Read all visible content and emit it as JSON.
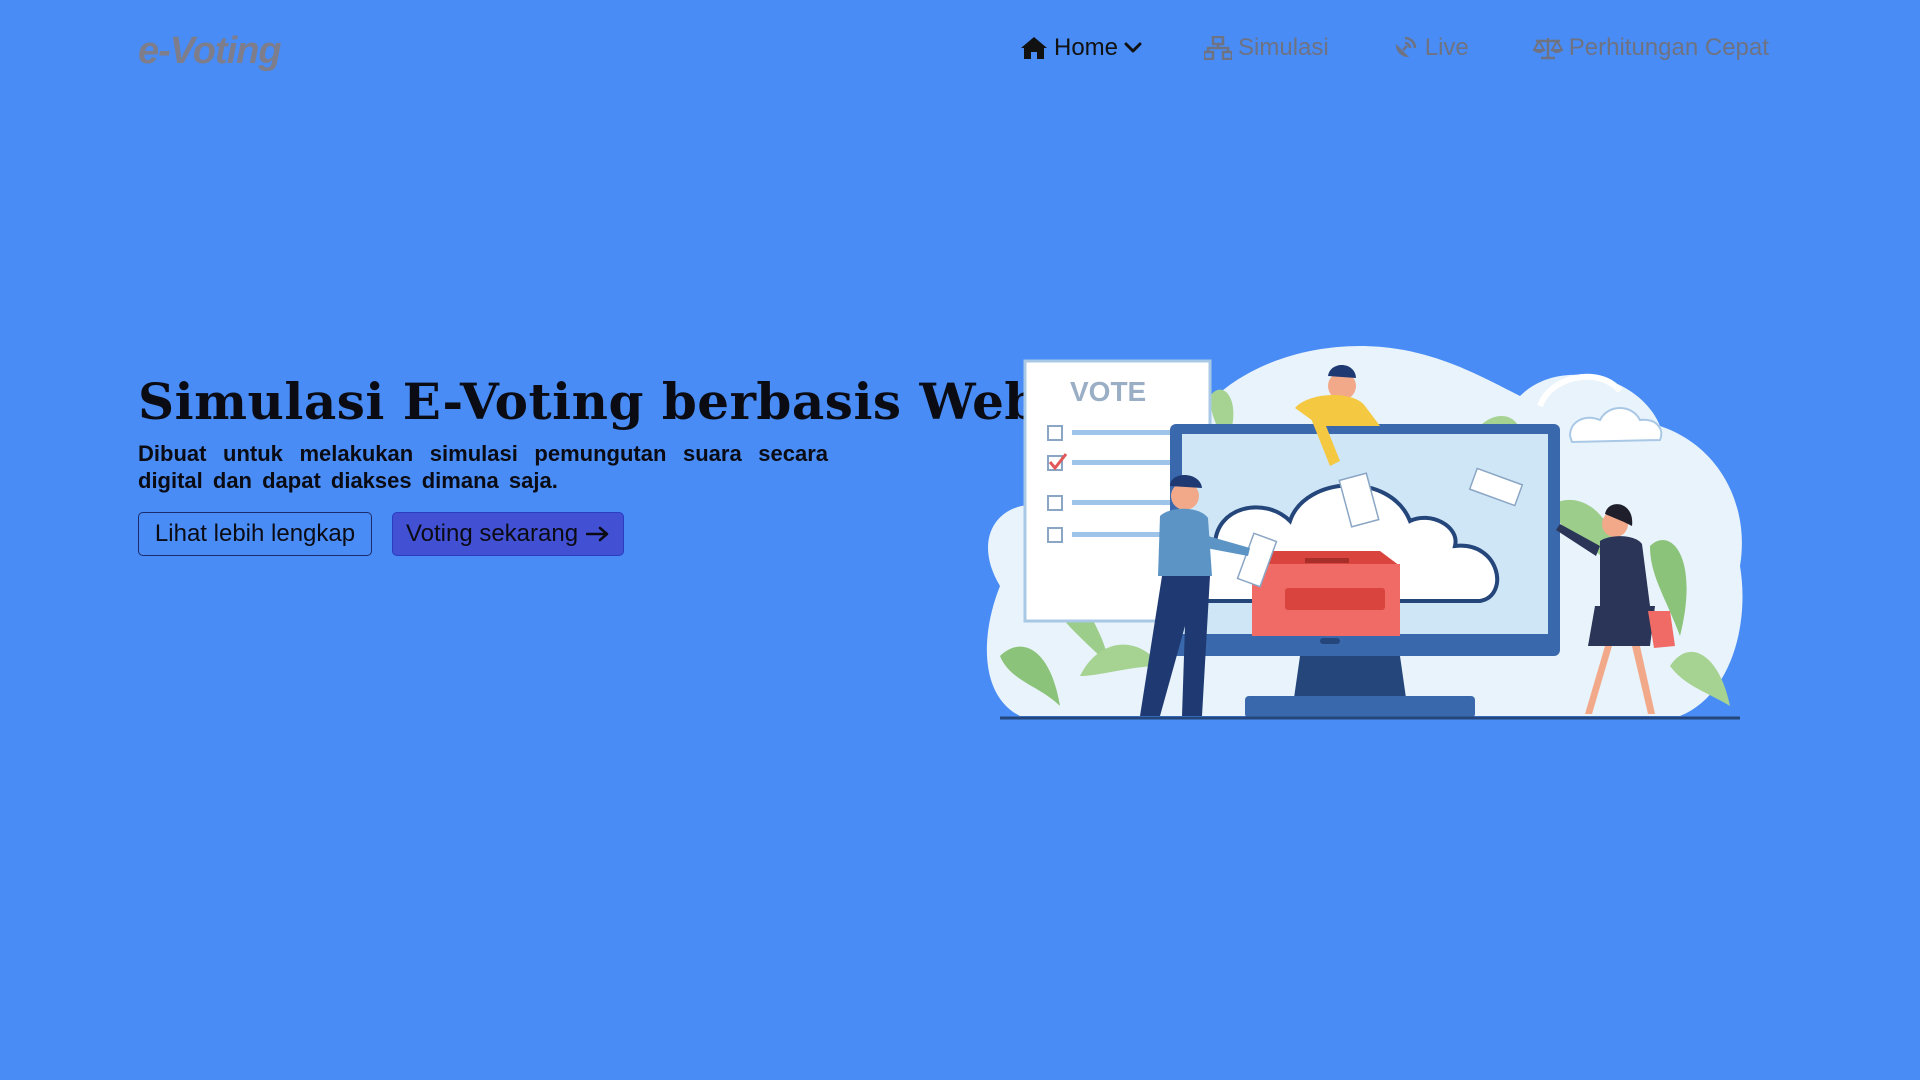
{
  "brand": {
    "name": "e-Voting"
  },
  "nav": {
    "items": [
      {
        "label": "Home",
        "icon": "home-icon",
        "active": true,
        "has_dropdown": true
      },
      {
        "label": "Simulasi",
        "icon": "sitemap-icon",
        "active": false
      },
      {
        "label": "Live",
        "icon": "satellite-dish-icon",
        "active": false
      },
      {
        "label": "Perhitungan Cepat",
        "icon": "balance-scale-icon",
        "active": false
      }
    ]
  },
  "hero": {
    "title": "Simulasi E-Voting berbasis Web",
    "subtitle": "Dibuat untuk melakukan simulasi pemungutan suara secara digital dan dapat diakses dimana saja.",
    "secondary_button": "Lihat lebih lengkap",
    "primary_button": "Voting sekarang",
    "primary_button_icon": "arrow-right-icon"
  },
  "illustration": {
    "vote_board_label": "VOTE"
  },
  "colors": {
    "background": "#498cf5",
    "primary_button": "#4250d4",
    "nav_text": "#6f7281",
    "nav_active": "#111111",
    "brand": "#7d7d8c"
  }
}
